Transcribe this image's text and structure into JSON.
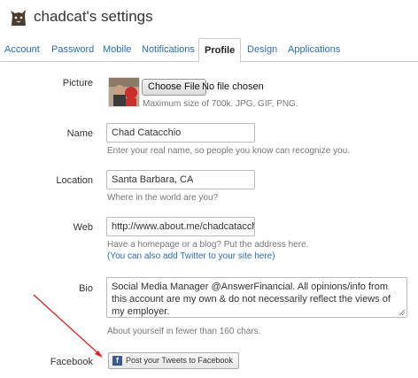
{
  "header": {
    "title": "chadcat's settings",
    "avatar_icon": "cat-avatar-icon"
  },
  "tabs": [
    {
      "label": "Account"
    },
    {
      "label": "Password"
    },
    {
      "label": "Mobile"
    },
    {
      "label": "Notifications"
    },
    {
      "label": "Profile",
      "active": true
    },
    {
      "label": "Design"
    },
    {
      "label": "Applications"
    }
  ],
  "picture": {
    "label": "Picture",
    "button_label": "Choose File",
    "status": "No file chosen",
    "hint": "Maximum size of 700k. JPG, GIF, PNG."
  },
  "name": {
    "label": "Name",
    "value": "Chad Catacchio",
    "hint": "Enter your real name, so people you know can recognize you."
  },
  "location": {
    "label": "Location",
    "value": "Santa Barbara, CA",
    "hint": "Where in the world are you?"
  },
  "web": {
    "label": "Web",
    "value": "http://www.about.me/chadcatacchio",
    "hint": "Have a homepage or a blog? Put the address here.",
    "link": "(You can also add Twitter to your site here)"
  },
  "bio": {
    "label": "Bio",
    "value": "Social Media Manager @AnswerFinancial. All opinions/info from this account are my own & do not necessarily reflect the views of my employer.",
    "hint": "About yourself in fewer than 160 chars."
  },
  "facebook": {
    "label": "Facebook",
    "button_label": "Post your Tweets to Facebook",
    "icon": "facebook-icon"
  },
  "colors": {
    "link": "#2a6db5",
    "annotation_arrow": "#e02020",
    "facebook": "#3b5998"
  }
}
